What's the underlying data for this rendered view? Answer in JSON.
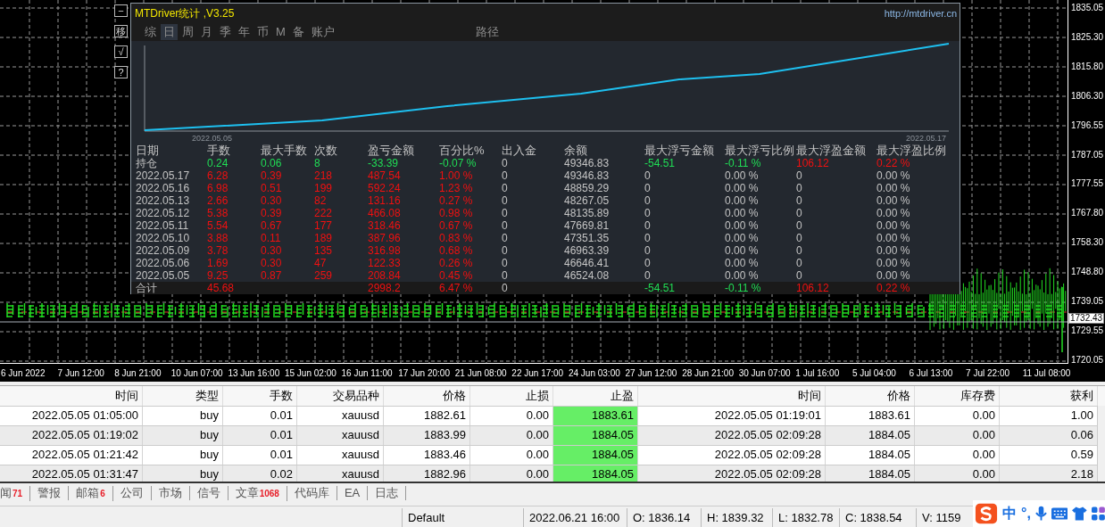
{
  "chart": {
    "side_buttons": [
      "−",
      "移",
      "√",
      "?"
    ],
    "price_ticks": [
      "1835.05",
      "1825.30",
      "1815.80",
      "1806.30",
      "1796.55",
      "1787.05",
      "1777.55",
      "1767.80",
      "1758.30",
      "1748.80",
      "1739.05",
      "1729.55",
      "1720.05"
    ],
    "current_price": "1732.43",
    "time_ticks": [
      "6 Jun 2022",
      "7 Jun 12:00",
      "8 Jun 21:00",
      "10 Jun 07:00",
      "13 Jun 16:00",
      "15 Jun 02:00",
      "16 Jun 11:00",
      "17 Jun 20:00",
      "21 Jun 08:00",
      "22 Jun 17:00",
      "24 Jun 03:00",
      "27 Jun 12:00",
      "28 Jun 21:00",
      "30 Jun 07:00",
      "1 Jul 16:00",
      "5 Jul 04:00",
      "6 Jul 13:00",
      "7 Jul 22:00",
      "11 Jul 08:00"
    ]
  },
  "stats_panel": {
    "title": "MTDriver统计 ,V3.25",
    "url": "http://mtdriver.cn",
    "tabs": [
      {
        "label": "综",
        "selected": false
      },
      {
        "label": "日",
        "selected": true
      },
      {
        "label": "周",
        "selected": false
      },
      {
        "label": "月",
        "selected": false
      },
      {
        "label": "季",
        "selected": false
      },
      {
        "label": "年",
        "selected": false
      },
      {
        "label": "币",
        "selected": false
      },
      {
        "label": "M",
        "selected": false
      },
      {
        "label": "备",
        "selected": false
      },
      {
        "label": "账户",
        "selected": false
      }
    ],
    "path_button": "路径",
    "equity_chart": {
      "start_date": "2022.05.05",
      "end_date": "2022.05.17"
    },
    "columns": [
      "日期",
      "手数",
      "最大手数",
      "次数",
      "盈亏金额",
      "百分比%",
      "出入金",
      "余额",
      "最大浮亏金额",
      "最大浮亏比例",
      "最大浮盈金额",
      "最大浮盈比例"
    ],
    "rows": [
      {
        "kind": "holding",
        "cells": [
          "持仓",
          "0.24",
          "0.06",
          "8",
          "-33.39",
          "-0.07 %",
          "0",
          "49346.83",
          "-54.51",
          "-0.11 %",
          "106.12",
          "0.22 %"
        ]
      },
      {
        "kind": "day",
        "cells": [
          "2022.05.17",
          "6.28",
          "0.39",
          "218",
          "487.54",
          "1.00 %",
          "0",
          "49346.83",
          "0",
          "0.00 %",
          "0",
          "0.00 %"
        ]
      },
      {
        "kind": "day",
        "cells": [
          "2022.05.16",
          "6.98",
          "0.51",
          "199",
          "592.24",
          "1.23 %",
          "0",
          "48859.29",
          "0",
          "0.00 %",
          "0",
          "0.00 %"
        ]
      },
      {
        "kind": "day",
        "cells": [
          "2022.05.13",
          "2.66",
          "0.30",
          "82",
          "131.16",
          "0.27 %",
          "0",
          "48267.05",
          "0",
          "0.00 %",
          "0",
          "0.00 %"
        ]
      },
      {
        "kind": "day",
        "cells": [
          "2022.05.12",
          "5.38",
          "0.39",
          "222",
          "466.08",
          "0.98 %",
          "0",
          "48135.89",
          "0",
          "0.00 %",
          "0",
          "0.00 %"
        ]
      },
      {
        "kind": "day",
        "cells": [
          "2022.05.11",
          "5.54",
          "0.67",
          "177",
          "318.46",
          "0.67 %",
          "0",
          "47669.81",
          "0",
          "0.00 %",
          "0",
          "0.00 %"
        ]
      },
      {
        "kind": "day",
        "cells": [
          "2022.05.10",
          "3.88",
          "0.11",
          "189",
          "387.96",
          "0.83 %",
          "0",
          "47351.35",
          "0",
          "0.00 %",
          "0",
          "0.00 %"
        ]
      },
      {
        "kind": "day",
        "cells": [
          "2022.05.09",
          "3.78",
          "0.30",
          "135",
          "316.98",
          "0.68 %",
          "0",
          "46963.39",
          "0",
          "0.00 %",
          "0",
          "0.00 %"
        ]
      },
      {
        "kind": "day",
        "cells": [
          "2022.05.06",
          "1.69",
          "0.30",
          "47",
          "122.33",
          "0.26 %",
          "0",
          "46646.41",
          "0",
          "0.00 %",
          "0",
          "0.00 %"
        ]
      },
      {
        "kind": "day",
        "cells": [
          "2022.05.05",
          "9.25",
          "0.87",
          "259",
          "208.84",
          "0.45 %",
          "0",
          "46524.08",
          "0",
          "0.00 %",
          "0",
          "0.00 %"
        ]
      },
      {
        "kind": "total",
        "cells": [
          "合计",
          "45.68",
          null,
          null,
          "2998.2",
          "6.47 %",
          "0",
          null,
          "-54.51",
          "-0.11 %",
          "106.12",
          "0.22 %"
        ]
      }
    ]
  },
  "orders_table": {
    "columns": [
      {
        "label": "时间",
        "highlighted": false
      },
      {
        "label": "类型",
        "highlighted": false
      },
      {
        "label": "手数",
        "highlighted": false
      },
      {
        "label": "交易品种",
        "highlighted": false
      },
      {
        "label": "价格",
        "highlighted": false
      },
      {
        "label": "止损",
        "highlighted": false
      },
      {
        "label": "止盈",
        "highlighted": true
      },
      {
        "label": "时间",
        "highlighted": false
      },
      {
        "label": "价格",
        "highlighted": false
      },
      {
        "label": "库存费",
        "highlighted": false
      },
      {
        "label": "获利",
        "highlighted": false
      }
    ],
    "rows": [
      [
        "2022.05.05 01:05:00",
        "buy",
        "0.01",
        "xauusd",
        "1882.61",
        "0.00",
        "1883.61",
        "2022.05.05 01:19:01",
        "1883.61",
        "0.00",
        "1.00"
      ],
      [
        "2022.05.05 01:19:02",
        "buy",
        "0.01",
        "xauusd",
        "1883.99",
        "0.00",
        "1884.05",
        "2022.05.05 02:09:28",
        "1884.05",
        "0.00",
        "0.06"
      ],
      [
        "2022.05.05 01:21:42",
        "buy",
        "0.01",
        "xauusd",
        "1883.46",
        "0.00",
        "1884.05",
        "2022.05.05 02:09:28",
        "1884.05",
        "0.00",
        "0.59"
      ],
      [
        "2022.05.05 01:31:47",
        "buy",
        "0.02",
        "xauusd",
        "1882.96",
        "0.00",
        "1884.05",
        "2022.05.05 02:09:28",
        "1884.05",
        "0.00",
        "2.18"
      ]
    ]
  },
  "terminal_tabs": [
    {
      "label": "闻",
      "badge": "71"
    },
    {
      "label": "警报"
    },
    {
      "label": "邮箱",
      "badge": "6"
    },
    {
      "label": "公司"
    },
    {
      "label": "市场"
    },
    {
      "label": "信号"
    },
    {
      "label": "文章",
      "badge": "1068"
    },
    {
      "label": "代码库"
    },
    {
      "label": "EA"
    },
    {
      "label": "日志"
    }
  ],
  "status_bar": [
    "Default",
    "2022.06.21 16:00",
    "O: 1836.14",
    "H: 1839.32",
    "L: 1832.78",
    "C: 1838.54",
    "V: 1159"
  ],
  "ime_toolbar": {
    "mode": "中",
    "punctuation": "°,"
  }
}
